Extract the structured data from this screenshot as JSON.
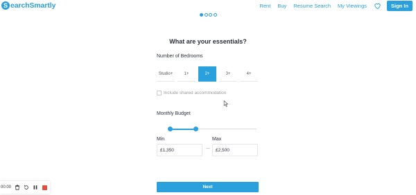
{
  "brand": {
    "logo_letter": "S",
    "name": "earchSmartly",
    "color": "#2aa0dc"
  },
  "nav": {
    "items": [
      "Rent",
      "Buy",
      "Resume Search",
      "My Viewings"
    ],
    "favorites_icon": "heart-icon",
    "signin_label": "Sign In"
  },
  "steps": {
    "total": 4,
    "current": 1
  },
  "page": {
    "title": "What are your essentials?"
  },
  "bedrooms": {
    "label": "Number of Bedrooms",
    "options": [
      "Studio+",
      "1+",
      "2+",
      "3+",
      "4+"
    ],
    "selected": "2+"
  },
  "shared": {
    "label": "Include shared accommodation",
    "checked": false
  },
  "budget": {
    "label": "Monthly Budget",
    "min_label": "Min",
    "max_label": "Max",
    "min_value": "£1,350",
    "max_value": "£2,500",
    "separator": "—"
  },
  "next_label": "Next",
  "recorder": {
    "time": "00:00",
    "icons": [
      "trash-icon",
      "restart-icon",
      "pause-icon",
      "stop-icon"
    ]
  },
  "colors": {
    "accent": "#2aa0dc",
    "stop": "#e84c3d"
  }
}
